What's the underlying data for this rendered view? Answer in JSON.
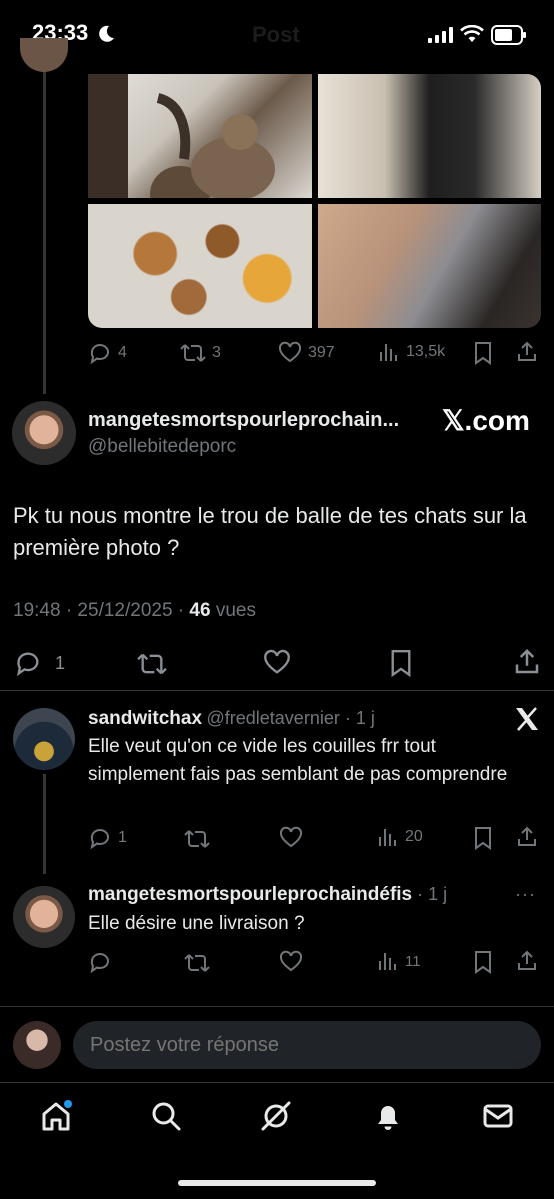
{
  "status": {
    "time": "23:33"
  },
  "header": {
    "title": "Post"
  },
  "parent_tweet": {
    "stats": {
      "replies": "4",
      "retweets": "3",
      "likes": "397",
      "views": "13,5k"
    }
  },
  "main_tweet": {
    "name": "mangetesmortspourleprochain...",
    "handle": "@bellebitedeporc",
    "watermark": "𝕏.com",
    "text": "Pk tu nous montre le trou de balle de tes chats sur la première photo ?",
    "time": "19:48 · 25/12/2025 · ",
    "views_count": "46",
    "views_label": " vues",
    "stats": {
      "replies": "1"
    }
  },
  "replies": [
    {
      "name": "sandwitchax",
      "handle": "@fredletavernier · 1 j",
      "text": "Elle veut qu'on ce vide les couilles frr tout simplement fais pas semblant de pas comprendre",
      "stats": {
        "replies": "1",
        "views": "20"
      }
    },
    {
      "name": "mangetesmortspourleprochaindéfis",
      "handle": " · 1 j",
      "text": "Elle désire une livraison ?",
      "stats": {
        "views": "11"
      }
    }
  ],
  "composer": {
    "placeholder": "Postez votre réponse"
  },
  "icons": {
    "reply": "reply-icon",
    "retweet": "retweet-icon",
    "like": "heart-icon",
    "views": "views-icon",
    "bookmark": "bookmark-icon",
    "share": "share-icon",
    "home": "home-icon",
    "search": "search-icon",
    "grok": "grok-icon",
    "notifications": "bell-icon",
    "messages": "mail-icon"
  },
  "colors": {
    "accent": "#1d9bf0",
    "muted": "#71767b",
    "text": "#e7e9ea",
    "background": "#000000"
  }
}
